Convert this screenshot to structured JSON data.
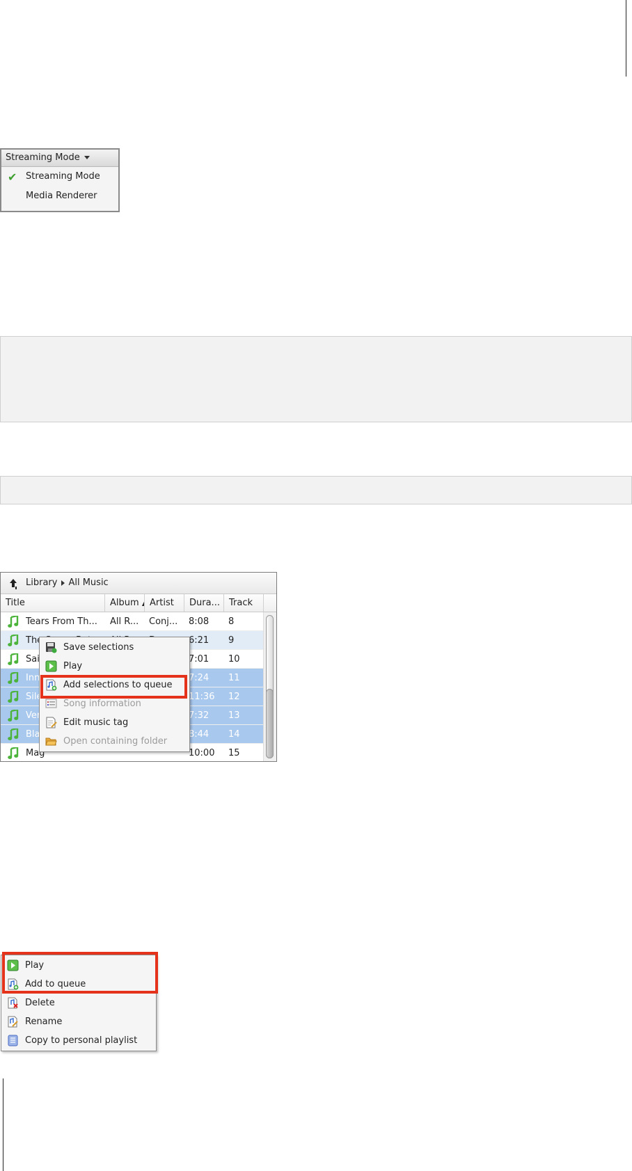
{
  "mode_menu": {
    "header_label": "Streaming Mode",
    "items": [
      {
        "label": "Streaming Mode",
        "checked": true
      },
      {
        "label": "Media Renderer",
        "checked": false
      }
    ]
  },
  "library": {
    "breadcrumb": {
      "root": "Library",
      "current": "All Music"
    },
    "columns": [
      "Title",
      "Album",
      "Artist",
      "Dura...",
      "Track"
    ],
    "rows": [
      {
        "title": "Tears From Th...",
        "album": "All R...",
        "artist": "Conj...",
        "duration": "8:08",
        "track": "8",
        "state": "normal"
      },
      {
        "title": "The Space Bet...",
        "album": "All R...",
        "artist": "Dave...",
        "duration": "6:21",
        "track": "9",
        "state": "hover"
      },
      {
        "title": "Sai",
        "album": "",
        "artist": "",
        "duration": "7:01",
        "track": "10",
        "state": "normal"
      },
      {
        "title": "Inn",
        "album": "",
        "artist": "",
        "duration": "7:24",
        "track": "11",
        "state": "selected"
      },
      {
        "title": "Sile",
        "album": "",
        "artist": "",
        "duration": "11:36",
        "track": "12",
        "state": "selected"
      },
      {
        "title": "Ver",
        "album": "",
        "artist": "",
        "duration": "7:32",
        "track": "13",
        "state": "selected"
      },
      {
        "title": "Bla",
        "album": "",
        "artist": "",
        "duration": "8:44",
        "track": "14",
        "state": "selected"
      },
      {
        "title": "Mag",
        "album": "",
        "artist": "",
        "duration": "10:00",
        "track": "15",
        "state": "normal"
      }
    ],
    "context_menu": [
      {
        "label": "Save selections",
        "icon": "save-icon",
        "disabled": false
      },
      {
        "label": "Play",
        "icon": "play-icon",
        "disabled": false
      },
      {
        "label": "Add selections to queue",
        "icon": "add-to-queue-icon",
        "disabled": false,
        "highlighted": true
      },
      {
        "label": "Song information",
        "icon": "info-icon",
        "disabled": true
      },
      {
        "label": "Edit music tag",
        "icon": "edit-tag-icon",
        "disabled": false
      },
      {
        "label": "Open containing folder",
        "icon": "folder-icon",
        "disabled": true
      }
    ]
  },
  "playlist_menu": {
    "items": [
      {
        "label": "Play",
        "icon": "play-icon",
        "highlighted": true
      },
      {
        "label": "Add to queue",
        "icon": "add-to-queue-icon",
        "highlighted": true
      },
      {
        "label": "Delete",
        "icon": "delete-icon",
        "highlighted": false
      },
      {
        "label": "Rename",
        "icon": "rename-icon",
        "highlighted": false
      },
      {
        "label": "Copy to personal playlist",
        "icon": "playlist-icon",
        "highlighted": false
      }
    ]
  },
  "colors": {
    "highlight_frame": "#e5331b",
    "selected_row": "#a9c8ee",
    "note_icon": "#4bb33a"
  }
}
